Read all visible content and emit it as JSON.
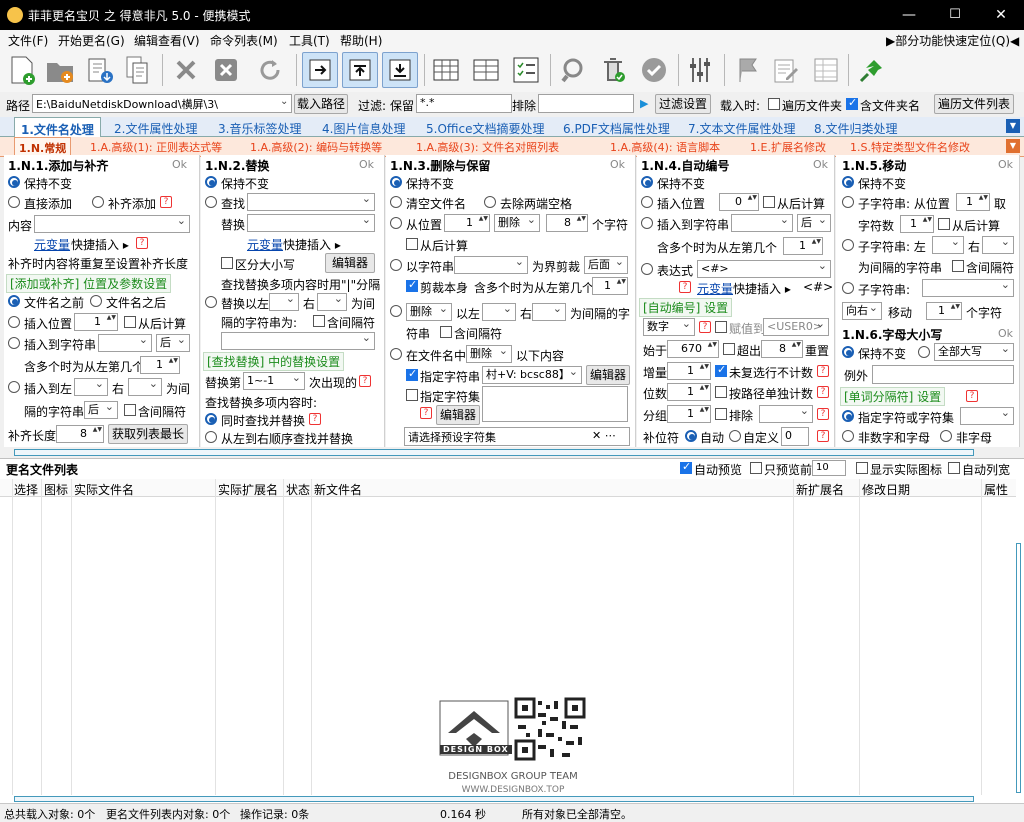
{
  "window": {
    "title": "菲菲更名宝贝 之 得意非凡 5.0 - 便携模式",
    "minimize": "—",
    "maximize": "☐",
    "close": "✕"
  },
  "menu": {
    "items": [
      "文件(F)",
      "开始更名(G)",
      "编辑查看(V)",
      "命令列表(M)",
      "工具(T)",
      "帮助(H)"
    ],
    "right": "▶部分功能快速定位(Q)◀"
  },
  "toolbar": {
    "icons": [
      "new-file-icon",
      "add-folder-icon",
      "import-icon",
      "copy-list-icon",
      "delete-icon",
      "clear-icon",
      "refresh-icon",
      "expand-right-icon",
      "move-up-icon",
      "move-down-icon",
      "split-view-icon",
      "grid-view-icon",
      "checklist-icon",
      "search-icon",
      "trash-icon",
      "check-icon",
      "settings-sliders-icon",
      "flag-icon",
      "edit-icon",
      "table-icon",
      "pin-icon"
    ]
  },
  "pathbar": {
    "path_label": "路径",
    "path_value": "E:\\BaiduNetdiskDownload\\横屏\\3\\",
    "load_path": "载入路径",
    "filter_label": "过滤:",
    "keep_label": "保留",
    "keep_value": "*.*",
    "exclude_label": "排除",
    "filter_settings": "过滤设置",
    "load_when": "载入时:",
    "traverse_files": "遍历文件夹",
    "include_folder_names": "含文件夹名",
    "traverse_list": "遍历文件列表"
  },
  "tabs_main": [
    "1.文件名处理",
    "2.文件属性处理",
    "3.音乐标签处理",
    "4.图片信息处理",
    "5.Office文档摘要处理",
    "6.PDF文档属性处理",
    "7.文本文件属性处理",
    "8.文件归类处理"
  ],
  "tabs_sub": [
    "1.N.常规",
    "1.A.高级(1): 正则表达式等",
    "1.A.高级(2): 编码与转换等",
    "1.A.高级(3): 文件名对照列表",
    "1.A.高级(4): 语言脚本",
    "1.E.扩展名修改",
    "1.S.特定类型文件名修改"
  ],
  "p1": {
    "title": "1.N.1.添加与补齐",
    "ok": "Ok",
    "keep": "保持不变",
    "direct_add": "直接添加",
    "pad_add": "补齐添加",
    "content": "内容",
    "var_link": "元变量",
    "quick_insert": "快捷插入 ▸",
    "note": "补齐时内容将重复至设置补齐长度",
    "sub": "[添加或补齐] 位置及参数设置",
    "before": "文件名之前",
    "after": "文件名之后",
    "insert_pos": "插入位置",
    "insert_pos_val": "1",
    "from_back": "从后计算",
    "insert_str": "插入到字符串",
    "after_opt": "后",
    "multi": "含多个时为从左第几个",
    "multi_val": "1",
    "insert_left": "插入到左",
    "right": "右",
    "between": "为间",
    "sep_str": "隔的字符串",
    "after2": "后",
    "contains_sep": "含间隔符",
    "pad_len": "补齐长度",
    "pad_len_val": "8",
    "get_max": "获取列表最长"
  },
  "p2": {
    "title": "1.N.2.替换",
    "ok": "Ok",
    "keep": "保持不变",
    "find": "查找",
    "replace": "替换",
    "var_link": "元变量",
    "quick_insert": "快捷插入 ▸",
    "case": "区分大小写",
    "editor": "编辑器",
    "note": "查找替换多项内容时用\"|\"分隔",
    "replace_left": "替换以左",
    "right": "右",
    "between": "为间",
    "sep_str": "隔的字符串为:",
    "contains_sep": "含间隔符",
    "sub": "[查找替换] 中的替换设置",
    "replace_nth": "替换第",
    "nth_val": "1~-1",
    "occurrence": "次出现的",
    "multi_when": "查找替换多项内容时:",
    "simultaneous": "同时查找并替换",
    "sequential": "从左到右顺序查找并替换"
  },
  "p3": {
    "title": "1.N.3.删除与保留",
    "ok": "Ok",
    "keep": "保持不变",
    "clear": "清空文件名",
    "trim": "去除两端空格",
    "from_pos": "从位置",
    "from_pos_val": "1",
    "delete": "删除",
    "delete_val": "8",
    "chars": "个字符",
    "from_back": "从后计算",
    "by_str": "以字符串",
    "cut_boundary": "为界剪裁",
    "after_opt": "后面",
    "cut_self": "剪裁本身",
    "multi": "含多个时为从左第几个",
    "multi_val": "1",
    "del_opt": "删除",
    "left_of": "以左",
    "right": "右",
    "between_chars": "为间隔的字",
    "str": "符串",
    "contains_sep": "含间隔符",
    "in_filename": "在文件名中",
    "del_opt2": "删除",
    "below": "以下内容",
    "specified_str": "指定字符串",
    "specified_val": "村+V: bcsc88】",
    "editor": "编辑器",
    "specified_set": "指定字符集",
    "editor2": "编辑器",
    "preset": "请选择预设字符集"
  },
  "p4": {
    "title": "1.N.4.自动编号",
    "ok": "Ok",
    "keep": "保持不变",
    "insert_pos": "插入位置",
    "insert_pos_val": "0",
    "from_back": "从后计算",
    "insert_str": "插入到字符串",
    "after_opt": "后",
    "multi": "含多个时为从左第几个",
    "multi_val": "1",
    "expr": "表达式",
    "expr_val": "<#>",
    "var_link": "元变量",
    "quick_insert": "快捷插入 ▸",
    "expr_hint": "<#>",
    "sub": "[自动编号] 设置",
    "numeral": "数字",
    "assign_to": "赋值到",
    "user_val": "<USER0>",
    "start": "始于",
    "start_val": "670",
    "exceed": "超出",
    "exceed_val": "8",
    "reset": "重置",
    "increment": "增量",
    "increment_val": "1",
    "skip_unselected": "未复选行不计数",
    "digits": "位数",
    "digits_val": "1",
    "by_path": "按路径单独计数",
    "group": "分组",
    "group_val": "1",
    "exclude": "排除",
    "pad_char": "补位符",
    "auto": "自动",
    "custom": "自定义",
    "custom_val": "0"
  },
  "p5": {
    "title": "1.N.5.移动",
    "ok": "Ok",
    "keep": "保持不变",
    "substr_from": "子字符串: 从位置",
    "substr_val": "1",
    "take": "取",
    "char_count": "字符数",
    "char_count_val": "1",
    "from_back": "从后计算",
    "substr_left": "子字符串: 左",
    "right": "右",
    "sep_str": "为间隔的字符串",
    "contains_sep": "含间隔符",
    "substr": "子字符串:",
    "direction": "向右",
    "move": "移动",
    "move_val": "1",
    "chars": "个字符"
  },
  "p6": {
    "title": "1.N.6.字母大小写",
    "ok": "Ok",
    "keep": "保持不变",
    "all_upper": "全部大写",
    "exception": "例外",
    "sub": "[单词分隔符] 设置",
    "spec_char": "指定字符或字符集",
    "non_digit_letter": "非数字和字母",
    "non_letter": "非字母"
  },
  "list": {
    "title": "更名文件列表",
    "auto_preview": "自动预览",
    "preview_first": "只预览前",
    "preview_val": "10",
    "show_icons": "显示实际图标",
    "auto_columns": "自动列宽",
    "columns": [
      "选择",
      "图标",
      "实际文件名",
      "实际扩展名",
      "状态",
      "新文件名",
      "新扩展名",
      "修改日期",
      "属性"
    ]
  },
  "watermark": {
    "brand": "DESIGN BOX",
    "team": "DESIGNBOX GROUP TEAM",
    "url": "WWW.DESIGNBOX.TOP"
  },
  "status": {
    "total": "总共载入对象: 0个",
    "rename": "更名文件列表内对象: 0个",
    "ops": "操作记录: 0条",
    "time": "0.164 秒",
    "msg": "所有对象已全部清空。"
  }
}
